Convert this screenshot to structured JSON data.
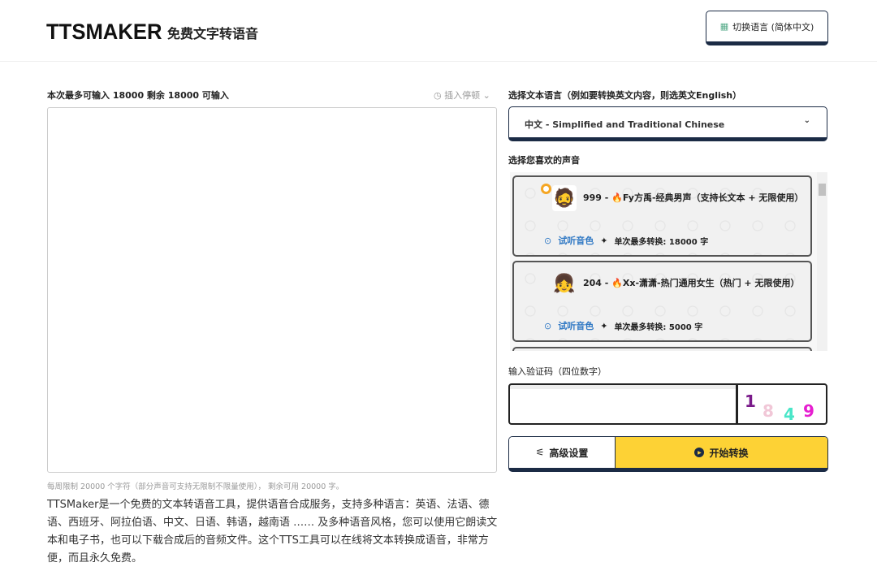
{
  "header": {
    "logo": "TTSMAKER",
    "tagline": "免费文字转语音",
    "lang_button": "切换语言 (简体中文)"
  },
  "left": {
    "input_label": "本次最多可输入 18000 剩余 18000 可输入",
    "pause_label": "插入停顿",
    "textarea_value": "",
    "note": "每周限制 20000 个字符（部分声音可支持无限制不限量使用），  剩余可用 20000 字。",
    "description": "TTSMaker是一个免费的文本转语音工具，提供语音合成服务，支持多种语言：英语、法语、德语、西班牙、阿拉伯语、中文、日语、韩语，越南语 …… 及多种语音风格，您可以使用它朗读文本和电子书，也可以下载合成后的音频文件。这个TTS工具可以在线将文本转换成语音，非常方便，而且永久免费。"
  },
  "right": {
    "language_label": "选择文本语言（例如要转换英文内容，则选英文English）",
    "language_selected": "中文 - Simplified and Traditional Chinese",
    "voice_label": "选择您喜欢的声音",
    "voices": [
      {
        "name": "999 - 🔥Fy方禹-经典男声（支持长文本 + 无限使用）",
        "listen": "试听音色",
        "max": "单次最多转换: 18000 字",
        "selected": true
      },
      {
        "name": "204 - 🔥Xx-潇潇-热门通用女生（热门 + 无限使用）",
        "listen": "试听音色",
        "max": "单次最多转换: 5000 字",
        "selected": false
      }
    ],
    "captcha_label": "输入验证码（四位数字）",
    "captcha_value": "",
    "captcha_digits": [
      "1",
      "8",
      "4",
      "9"
    ],
    "advanced_button": "高级设置",
    "start_button": "开始转换"
  },
  "colors": {
    "accent": "#fdd235",
    "navy": "#1b2b45",
    "link": "#2f78c4"
  }
}
